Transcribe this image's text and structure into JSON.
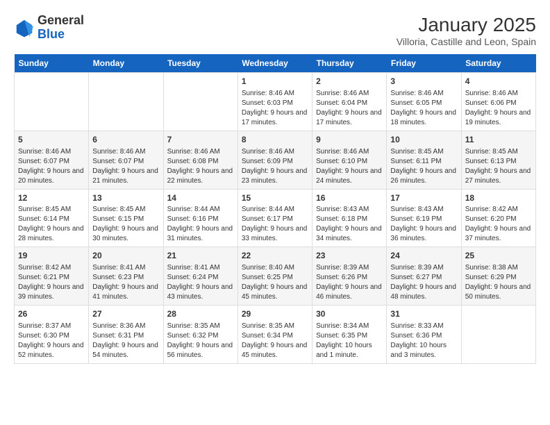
{
  "header": {
    "logo_general": "General",
    "logo_blue": "Blue",
    "title": "January 2025",
    "subtitle": "Villoria, Castille and Leon, Spain"
  },
  "days_of_week": [
    "Sunday",
    "Monday",
    "Tuesday",
    "Wednesday",
    "Thursday",
    "Friday",
    "Saturday"
  ],
  "weeks": [
    [
      {
        "day": "",
        "info": ""
      },
      {
        "day": "",
        "info": ""
      },
      {
        "day": "",
        "info": ""
      },
      {
        "day": "1",
        "info": "Sunrise: 8:46 AM\nSunset: 6:03 PM\nDaylight: 9 hours and 17 minutes."
      },
      {
        "day": "2",
        "info": "Sunrise: 8:46 AM\nSunset: 6:04 PM\nDaylight: 9 hours and 17 minutes."
      },
      {
        "day": "3",
        "info": "Sunrise: 8:46 AM\nSunset: 6:05 PM\nDaylight: 9 hours and 18 minutes."
      },
      {
        "day": "4",
        "info": "Sunrise: 8:46 AM\nSunset: 6:06 PM\nDaylight: 9 hours and 19 minutes."
      }
    ],
    [
      {
        "day": "5",
        "info": "Sunrise: 8:46 AM\nSunset: 6:07 PM\nDaylight: 9 hours and 20 minutes."
      },
      {
        "day": "6",
        "info": "Sunrise: 8:46 AM\nSunset: 6:07 PM\nDaylight: 9 hours and 21 minutes."
      },
      {
        "day": "7",
        "info": "Sunrise: 8:46 AM\nSunset: 6:08 PM\nDaylight: 9 hours and 22 minutes."
      },
      {
        "day": "8",
        "info": "Sunrise: 8:46 AM\nSunset: 6:09 PM\nDaylight: 9 hours and 23 minutes."
      },
      {
        "day": "9",
        "info": "Sunrise: 8:46 AM\nSunset: 6:10 PM\nDaylight: 9 hours and 24 minutes."
      },
      {
        "day": "10",
        "info": "Sunrise: 8:45 AM\nSunset: 6:11 PM\nDaylight: 9 hours and 26 minutes."
      },
      {
        "day": "11",
        "info": "Sunrise: 8:45 AM\nSunset: 6:13 PM\nDaylight: 9 hours and 27 minutes."
      }
    ],
    [
      {
        "day": "12",
        "info": "Sunrise: 8:45 AM\nSunset: 6:14 PM\nDaylight: 9 hours and 28 minutes."
      },
      {
        "day": "13",
        "info": "Sunrise: 8:45 AM\nSunset: 6:15 PM\nDaylight: 9 hours and 30 minutes."
      },
      {
        "day": "14",
        "info": "Sunrise: 8:44 AM\nSunset: 6:16 PM\nDaylight: 9 hours and 31 minutes."
      },
      {
        "day": "15",
        "info": "Sunrise: 8:44 AM\nSunset: 6:17 PM\nDaylight: 9 hours and 33 minutes."
      },
      {
        "day": "16",
        "info": "Sunrise: 8:43 AM\nSunset: 6:18 PM\nDaylight: 9 hours and 34 minutes."
      },
      {
        "day": "17",
        "info": "Sunrise: 8:43 AM\nSunset: 6:19 PM\nDaylight: 9 hours and 36 minutes."
      },
      {
        "day": "18",
        "info": "Sunrise: 8:42 AM\nSunset: 6:20 PM\nDaylight: 9 hours and 37 minutes."
      }
    ],
    [
      {
        "day": "19",
        "info": "Sunrise: 8:42 AM\nSunset: 6:21 PM\nDaylight: 9 hours and 39 minutes."
      },
      {
        "day": "20",
        "info": "Sunrise: 8:41 AM\nSunset: 6:23 PM\nDaylight: 9 hours and 41 minutes."
      },
      {
        "day": "21",
        "info": "Sunrise: 8:41 AM\nSunset: 6:24 PM\nDaylight: 9 hours and 43 minutes."
      },
      {
        "day": "22",
        "info": "Sunrise: 8:40 AM\nSunset: 6:25 PM\nDaylight: 9 hours and 45 minutes."
      },
      {
        "day": "23",
        "info": "Sunrise: 8:39 AM\nSunset: 6:26 PM\nDaylight: 9 hours and 46 minutes."
      },
      {
        "day": "24",
        "info": "Sunrise: 8:39 AM\nSunset: 6:27 PM\nDaylight: 9 hours and 48 minutes."
      },
      {
        "day": "25",
        "info": "Sunrise: 8:38 AM\nSunset: 6:29 PM\nDaylight: 9 hours and 50 minutes."
      }
    ],
    [
      {
        "day": "26",
        "info": "Sunrise: 8:37 AM\nSunset: 6:30 PM\nDaylight: 9 hours and 52 minutes."
      },
      {
        "day": "27",
        "info": "Sunrise: 8:36 AM\nSunset: 6:31 PM\nDaylight: 9 hours and 54 minutes."
      },
      {
        "day": "28",
        "info": "Sunrise: 8:35 AM\nSunset: 6:32 PM\nDaylight: 9 hours and 56 minutes."
      },
      {
        "day": "29",
        "info": "Sunrise: 8:35 AM\nSunset: 6:34 PM\nDaylight: 9 hours and 45 minutes."
      },
      {
        "day": "30",
        "info": "Sunrise: 8:34 AM\nSunset: 6:35 PM\nDaylight: 10 hours and 1 minute."
      },
      {
        "day": "31",
        "info": "Sunrise: 8:33 AM\nSunset: 6:36 PM\nDaylight: 10 hours and 3 minutes."
      },
      {
        "day": "",
        "info": ""
      }
    ]
  ]
}
